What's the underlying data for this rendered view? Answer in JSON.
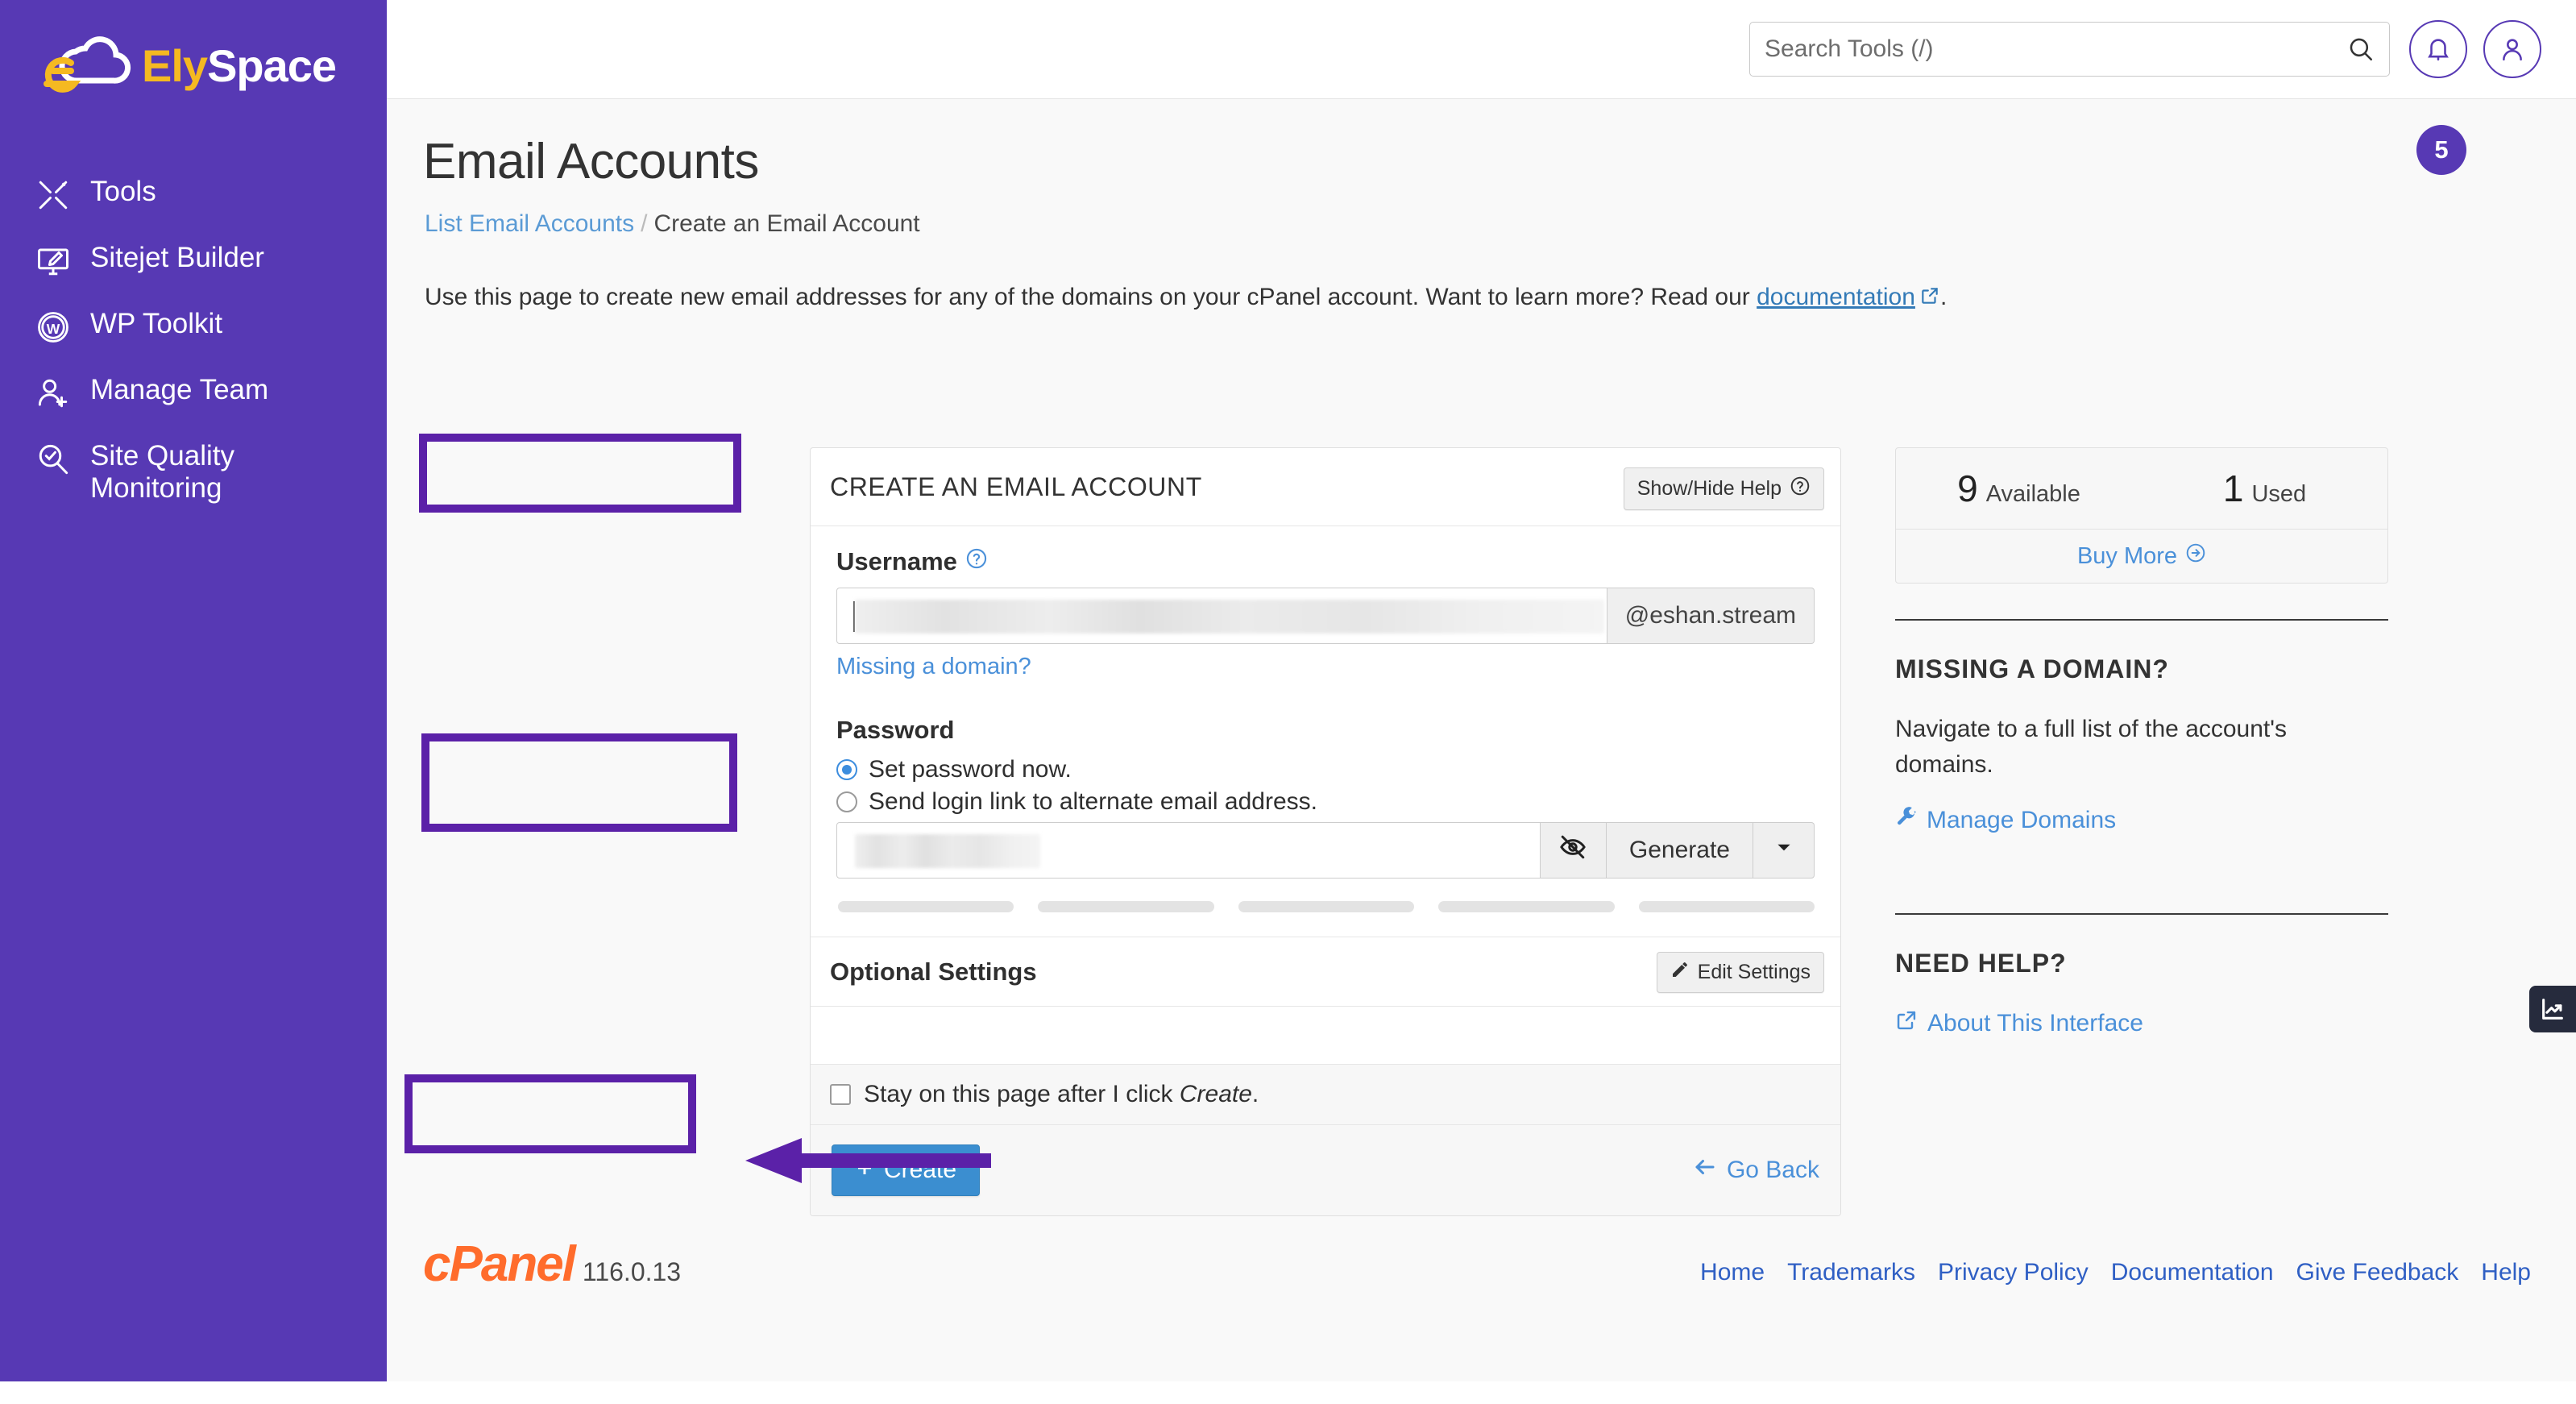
{
  "brand": {
    "name_part1": "Ely",
    "name_part2": "Space"
  },
  "sidebar": {
    "items": [
      {
        "label": "Tools",
        "icon": "tools-icon"
      },
      {
        "label": "Sitejet Builder",
        "icon": "monitor-pencil-icon"
      },
      {
        "label": "WP Toolkit",
        "icon": "wordpress-icon"
      },
      {
        "label": "Manage Team",
        "icon": "users-add-icon"
      },
      {
        "label": "Site Quality Monitoring",
        "icon": "search-check-icon"
      }
    ]
  },
  "topbar": {
    "search_placeholder": "Search Tools (/)",
    "search_value": "",
    "notification_count": "5"
  },
  "page": {
    "title": "Email Accounts",
    "breadcrumb_link": "List Email Accounts",
    "breadcrumb_sep": "/",
    "breadcrumb_current": "Create an Email Account",
    "intro_before": "Use this page to create new email addresses for any of the domains on your cPanel account. Want to learn more? Read our ",
    "intro_link": "documentation",
    "intro_after": "."
  },
  "form": {
    "card_title": "CREATE AN EMAIL ACCOUNT",
    "show_hide_help": "Show/Hide Help",
    "username_label": "Username",
    "username_value": "",
    "domain_addon": "@eshan.stream",
    "missing_domain_link": "Missing a domain?",
    "password_label": "Password",
    "radio_set_now": "Set password now.",
    "radio_send_link": "Send login link to alternate email address.",
    "password_value": "",
    "generate_label": "Generate",
    "optional_settings": "Optional Settings",
    "edit_settings": "Edit Settings",
    "stay_text_before": "Stay on this page after I click ",
    "stay_text_em": "Create",
    "stay_text_after": ".",
    "create_label": "Create",
    "go_back_label": "Go Back"
  },
  "quota": {
    "available_num": "9",
    "available_label": "Available",
    "used_num": "1",
    "used_label": "Used",
    "buy_more": "Buy More"
  },
  "aside": {
    "missing_domain_heading": "MISSING A DOMAIN?",
    "missing_domain_text": "Navigate to a full list of the account's domains.",
    "manage_domains_link": "Manage Domains",
    "need_help_heading": "NEED HELP?",
    "about_interface_link": "About This Interface"
  },
  "footer": {
    "cpanel_word": "cPanel",
    "version": "116.0.13",
    "links": [
      "Home",
      "Trademarks",
      "Privacy Policy",
      "Documentation",
      "Give Feedback",
      "Help"
    ]
  },
  "colors": {
    "sidebar_purple": "#5739b4",
    "highlight_purple": "#5b21a8",
    "brand_yellow": "#f5b921",
    "primary_blue": "#3b8ed0",
    "link_blue": "#4a90d9",
    "cpanel_orange": "#ff6c2c"
  }
}
